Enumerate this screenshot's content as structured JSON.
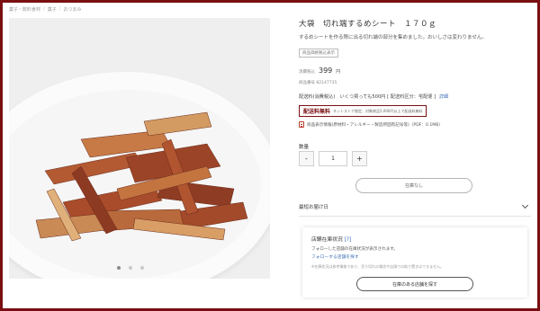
{
  "breadcrumb": [
    "菓子・飲料食材",
    "菓子",
    "おつまみ"
  ],
  "gallery": {
    "dots": 3,
    "active_dot": 0
  },
  "product": {
    "title": "大袋　切れ端するめシート　１７０ｇ",
    "description": "するめシートを作る際に出る切れ端の部分を集めました。おいしさは変わりません。",
    "tag": "商品価格税込表示",
    "price_label": "消費税込",
    "price": "399",
    "yen": "円",
    "item_number": "商品番号 82147735"
  },
  "shipping": {
    "text": "配送料(消費税込)　いくつ買っても500円 [ 配送料区分：宅配便 ]",
    "details_link": "詳細",
    "free_label": "配送料無料",
    "free_note": "ネットストア限定、対象商品5,000円以上で配送料無料",
    "info_link": "商品表示情報(原材料・アレルギー・製造所固有記号等)（PDF：0.1MB）"
  },
  "quantity": {
    "label": "数量",
    "minus": "-",
    "value": "1",
    "plus": "+"
  },
  "cart_button": "在庫なし",
  "delivery_label": "最短お届け日",
  "store": {
    "title": "店舗在庫状況",
    "help": "[?]",
    "text": "フォローした店舗の在庫状況が表示されます。",
    "follow_link": "フォローする店舗を探す",
    "note": "※在庫状況は参考情報であり、売り切れの場合や店頭での取り置きはできません。",
    "button": "在庫のある店舗を探す"
  },
  "colors": {
    "frame": "#7a0f12",
    "link": "#3b6fb6",
    "food": "#b0552f"
  }
}
